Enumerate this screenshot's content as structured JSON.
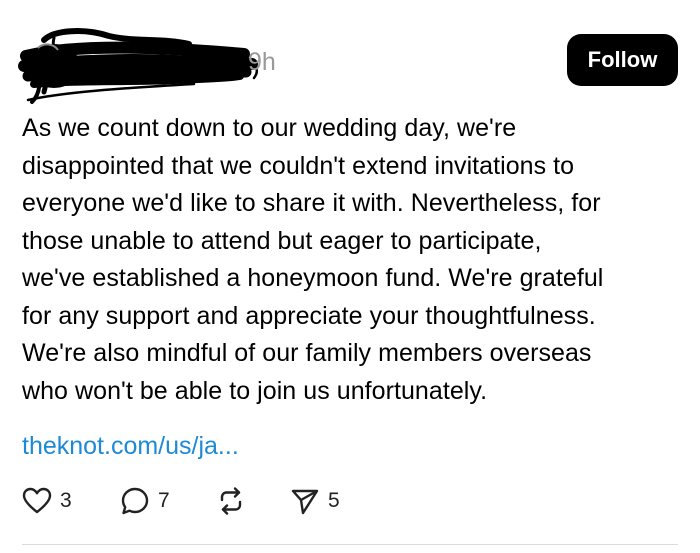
{
  "post": {
    "timestamp": "9h",
    "follow_label": "Follow",
    "text_lines": [
      "As we count down to our wedding day, we're",
      "disappointed that we couldn't extend invitations to",
      "everyone we'd like to share it with. Nevertheless, for",
      "those unable to attend but eager to participate,",
      "we've established a honeymoon fund. We're grateful",
      "for any support and appreciate your thoughtfulness.",
      "We're also mindful of our family members overseas",
      "who won't be able to join us unfortunately."
    ],
    "link_text": "theknot.com/us/ja...",
    "link_color": "#1d8ad6"
  },
  "actions": {
    "like_icon": "heart-icon",
    "like_count": "3",
    "reply_icon": "comment-icon",
    "reply_count": "7",
    "repost_icon": "repost-icon",
    "share_icon": "send-icon",
    "share_count": "5"
  }
}
